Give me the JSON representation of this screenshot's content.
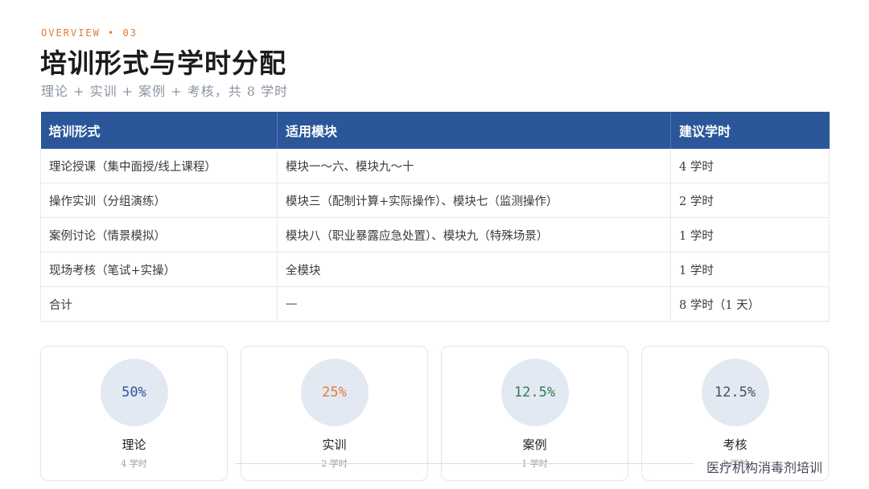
{
  "header": {
    "eyebrow": "OVERVIEW • 03",
    "title": "培训形式与学时分配",
    "subtitle": "理论 + 实训 + 案例 + 考核，共 8 学时"
  },
  "table": {
    "columns": [
      "培训形式",
      "适用模块",
      "建议学时"
    ],
    "rows": [
      [
        "理论授课（集中面授/线上课程）",
        "模块一～六、模块九～十",
        "4 学时"
      ],
      [
        "操作实训（分组演练）",
        "模块三（配制计算+实际操作）、模块七（监测操作）",
        "2 学时"
      ],
      [
        "案例讨论（情景模拟）",
        "模块八（职业暴露应急处置）、模块九（特殊场景）",
        "1 学时"
      ],
      [
        "现场考核（笔试+实操）",
        "全模块",
        "1 学时"
      ],
      [
        "合计",
        "—",
        "8 学时（1 天）"
      ]
    ]
  },
  "cards": [
    {
      "percent": "50%",
      "label": "理论",
      "hours": "4 学时",
      "color": "#2b579a"
    },
    {
      "percent": "25%",
      "label": "实训",
      "hours": "2 学时",
      "color": "#e07a3a"
    },
    {
      "percent": "12.5%",
      "label": "案例",
      "hours": "1 学时",
      "color": "#2e7d4f"
    },
    {
      "percent": "12.5%",
      "label": "考核",
      "hours": "1 学时",
      "color": "#4a4f5a"
    }
  ],
  "footer": {
    "text": "医疗机构消毒剂培训"
  },
  "colors": {
    "header_bg": "#2b579a",
    "accent": "#e07a3a"
  }
}
